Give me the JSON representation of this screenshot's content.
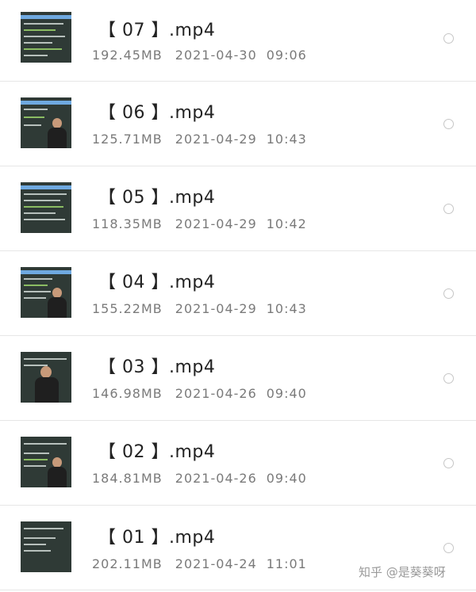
{
  "files": [
    {
      "name": "【 07 】.mp4",
      "size": "192.45MB",
      "date": "2021-04-30",
      "time": "09:06",
      "thumbnail": "lecture-slide-thumbnail"
    },
    {
      "name": "【 06 】.mp4",
      "size": "125.71MB",
      "date": "2021-04-29",
      "time": "10:43",
      "thumbnail": "lecture-slide-thumbnail"
    },
    {
      "name": "【 05 】.mp4",
      "size": "118.35MB",
      "date": "2021-04-29",
      "time": "10:42",
      "thumbnail": "lecture-slide-thumbnail"
    },
    {
      "name": "【 04 】.mp4",
      "size": "155.22MB",
      "date": "2021-04-29",
      "time": "10:43",
      "thumbnail": "lecture-slide-thumbnail"
    },
    {
      "name": "【 03 】.mp4",
      "size": "146.98MB",
      "date": "2021-04-26",
      "time": "09:40",
      "thumbnail": "lecture-slide-thumbnail"
    },
    {
      "name": "【 02 】.mp4",
      "size": "184.81MB",
      "date": "2021-04-26",
      "time": "09:40",
      "thumbnail": "lecture-slide-thumbnail"
    },
    {
      "name": "【 01 】.mp4",
      "size": "202.11MB",
      "date": "2021-04-24",
      "time": "11:01",
      "thumbnail": "lecture-slide-thumbnail"
    }
  ],
  "watermark": "知乎 @是葵葵呀",
  "colors": {
    "title": "#222222",
    "meta": "#7a7a7a",
    "divider": "#e6e6e6",
    "radio_border": "#c6c6c6",
    "thumbnail_bg": "#2f3a36"
  }
}
